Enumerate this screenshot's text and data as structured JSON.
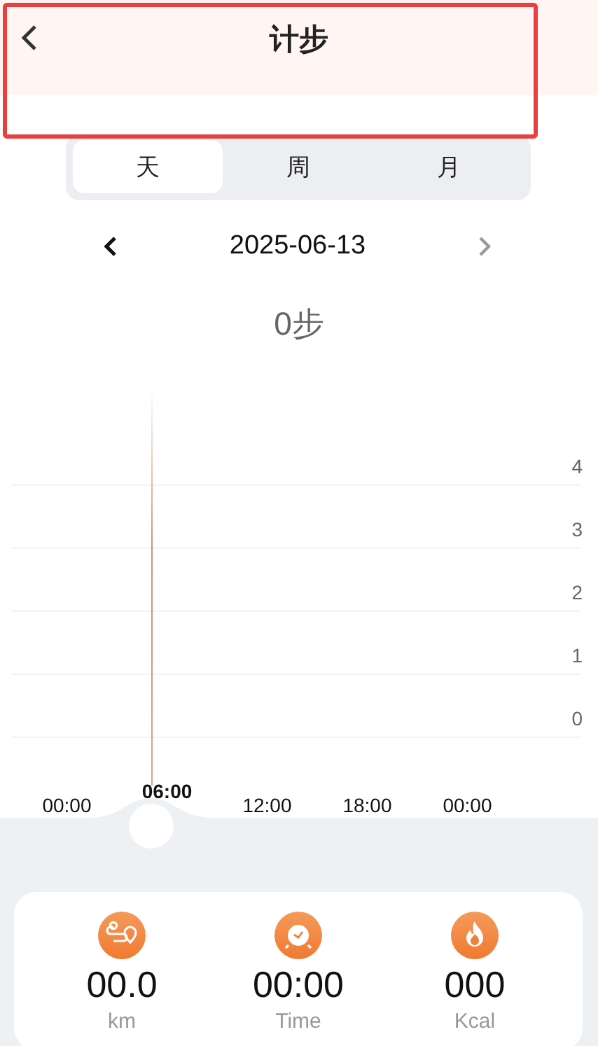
{
  "header": {
    "title": "计步"
  },
  "period_tabs": [
    {
      "label": "天",
      "selected": true
    },
    {
      "label": "周",
      "selected": false
    },
    {
      "label": "月",
      "selected": false
    }
  ],
  "date_nav": {
    "date": "2025-06-13",
    "next_disabled": true
  },
  "total": "0步",
  "chart": {
    "y_labels": [
      "4",
      "3",
      "2",
      "1",
      "0"
    ],
    "x_labels": [
      {
        "label": "00:00",
        "selected": false
      },
      {
        "label": "06:00",
        "selected": true
      },
      {
        "label": "12:00",
        "selected": false
      },
      {
        "label": "18:00",
        "selected": false
      },
      {
        "label": "00:00",
        "selected": false
      }
    ]
  },
  "stats": [
    {
      "kind": "distance",
      "value": "00.0",
      "unit": "km"
    },
    {
      "kind": "time",
      "value": "00:00",
      "unit": "Time"
    },
    {
      "kind": "calories",
      "value": "000",
      "unit": "Kcal"
    }
  ]
}
